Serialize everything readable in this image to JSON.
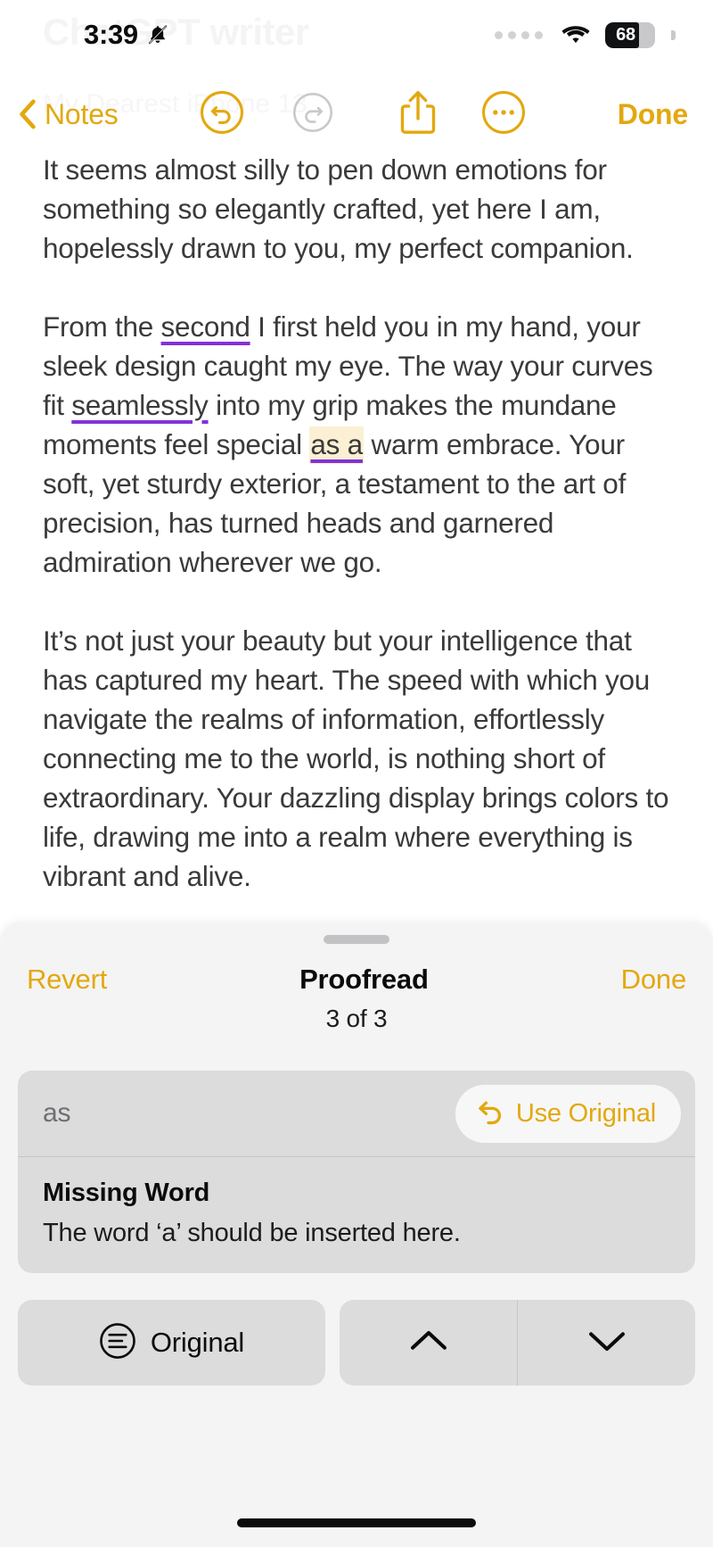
{
  "status_bar": {
    "time": "3:39",
    "bell_icon": "bell-slash-icon",
    "signal_icon": "cellular-dots-icon",
    "wifi_icon": "wifi-icon",
    "battery_percent": "68",
    "battery_level": 68
  },
  "ghost_note": {
    "title": "ChatGPT writer",
    "subtitle": "My Dearest iPhone 13,"
  },
  "toolbar": {
    "back_label": "Notes",
    "back_icon": "chevron-left-icon",
    "undo_icon": "undo-circle-icon",
    "redo_icon": "redo-circle-icon",
    "share_icon": "share-up-icon",
    "more_icon": "ellipsis-circle-icon",
    "done_label": "Done"
  },
  "note": {
    "paragraphs": [
      {
        "id": "p1",
        "runs": [
          {
            "text": "It seems almost silly to pen down emotions for something so elegantly crafted, yet here I am, hopelessly drawn to you, my perfect companion.",
            "style": "plain"
          }
        ]
      },
      {
        "id": "p2",
        "runs": [
          {
            "text": "From the ",
            "style": "plain"
          },
          {
            "text": "second",
            "style": "underline-purple"
          },
          {
            "text": " I first held you in my hand, your sleek design caught my eye. The way your curves fit ",
            "style": "plain"
          },
          {
            "text": "seamlessly",
            "style": "underline-purple"
          },
          {
            "text": " into my grip makes the mundane moments feel special ",
            "style": "plain"
          },
          {
            "text": "as a",
            "style": "highlight-suggestion"
          },
          {
            "text": "  warm embrace. Your soft, yet sturdy exterior, a testament to the art of precision, has turned heads and garnered admiration wherever we go.",
            "style": "plain"
          }
        ]
      },
      {
        "id": "p3",
        "runs": [
          {
            "text": "It’s not just your beauty but your intelligence that has captured my heart. The speed with which you navigate the realms of information, effortlessly connecting me to the world, is nothing short of extraordinary. Your dazzling display brings colors to life, drawing me into a realm where everything is vibrant and alive.",
            "style": "plain"
          }
        ]
      }
    ]
  },
  "proofread_sheet": {
    "revert_label": "Revert",
    "title": "Proofread",
    "done_label": "Done",
    "counter": "3 of 3",
    "suggestion": {
      "original_word": "as",
      "use_original_label": "Use Original",
      "use_original_icon": "undo-arrow-icon",
      "kind": "Missing Word",
      "description": "The word ‘a’ should be inserted here."
    },
    "actions": {
      "original_label": "Original",
      "original_icon": "document-lines-icon",
      "prev_icon": "chevron-up-icon",
      "next_icon": "chevron-down-icon"
    }
  },
  "colors": {
    "accent": "#E3A80E",
    "suggestion_underline": "#8331D9",
    "suggestion_highlight": "#FBF0D3",
    "text": "#3a3a3c",
    "sheet_bg": "#F4F4F4",
    "card_bg": "#DCDCDC"
  }
}
